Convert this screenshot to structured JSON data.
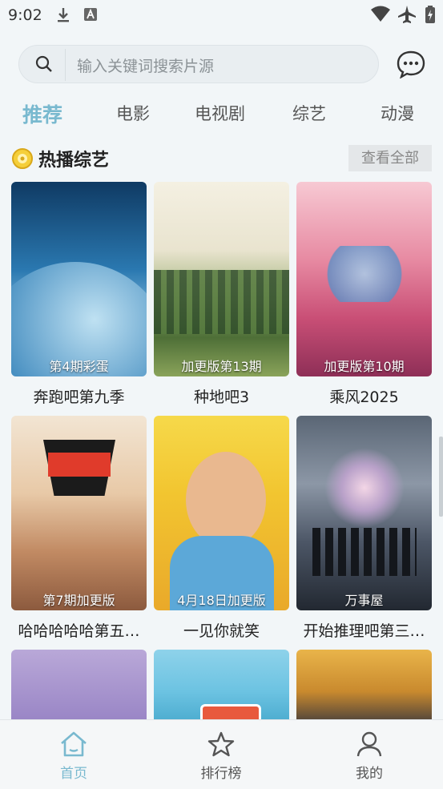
{
  "status_bar": {
    "time": "9:02"
  },
  "search": {
    "placeholder": "输入关键词搜索片源"
  },
  "tabs": [
    {
      "label": "推荐",
      "active": true
    },
    {
      "label": "电影",
      "active": false
    },
    {
      "label": "电视剧",
      "active": false
    },
    {
      "label": "综艺",
      "active": false
    },
    {
      "label": "动漫",
      "active": false
    }
  ],
  "section": {
    "title": "热播综艺",
    "see_all_label": "查看全部"
  },
  "cards": [
    {
      "title": "奔跑吧第九季",
      "caption": "第4期彩蛋"
    },
    {
      "title": "种地吧3",
      "caption": "加更版第13期"
    },
    {
      "title": "乘风2025",
      "caption": "加更版第10期"
    },
    {
      "title": "哈哈哈哈哈第五…",
      "caption": "第7期加更版"
    },
    {
      "title": "一见你就笑",
      "caption": "4月18日加更版"
    },
    {
      "title": "开始推理吧第三…",
      "caption": "万事屋"
    }
  ],
  "bottom_nav": [
    {
      "label": "首页",
      "icon": "home-icon",
      "active": true
    },
    {
      "label": "排行榜",
      "icon": "star-icon",
      "active": false
    },
    {
      "label": "我的",
      "icon": "user-icon",
      "active": false
    }
  ],
  "colors": {
    "accent": "#79b9cf",
    "background": "#f2f6f8"
  }
}
